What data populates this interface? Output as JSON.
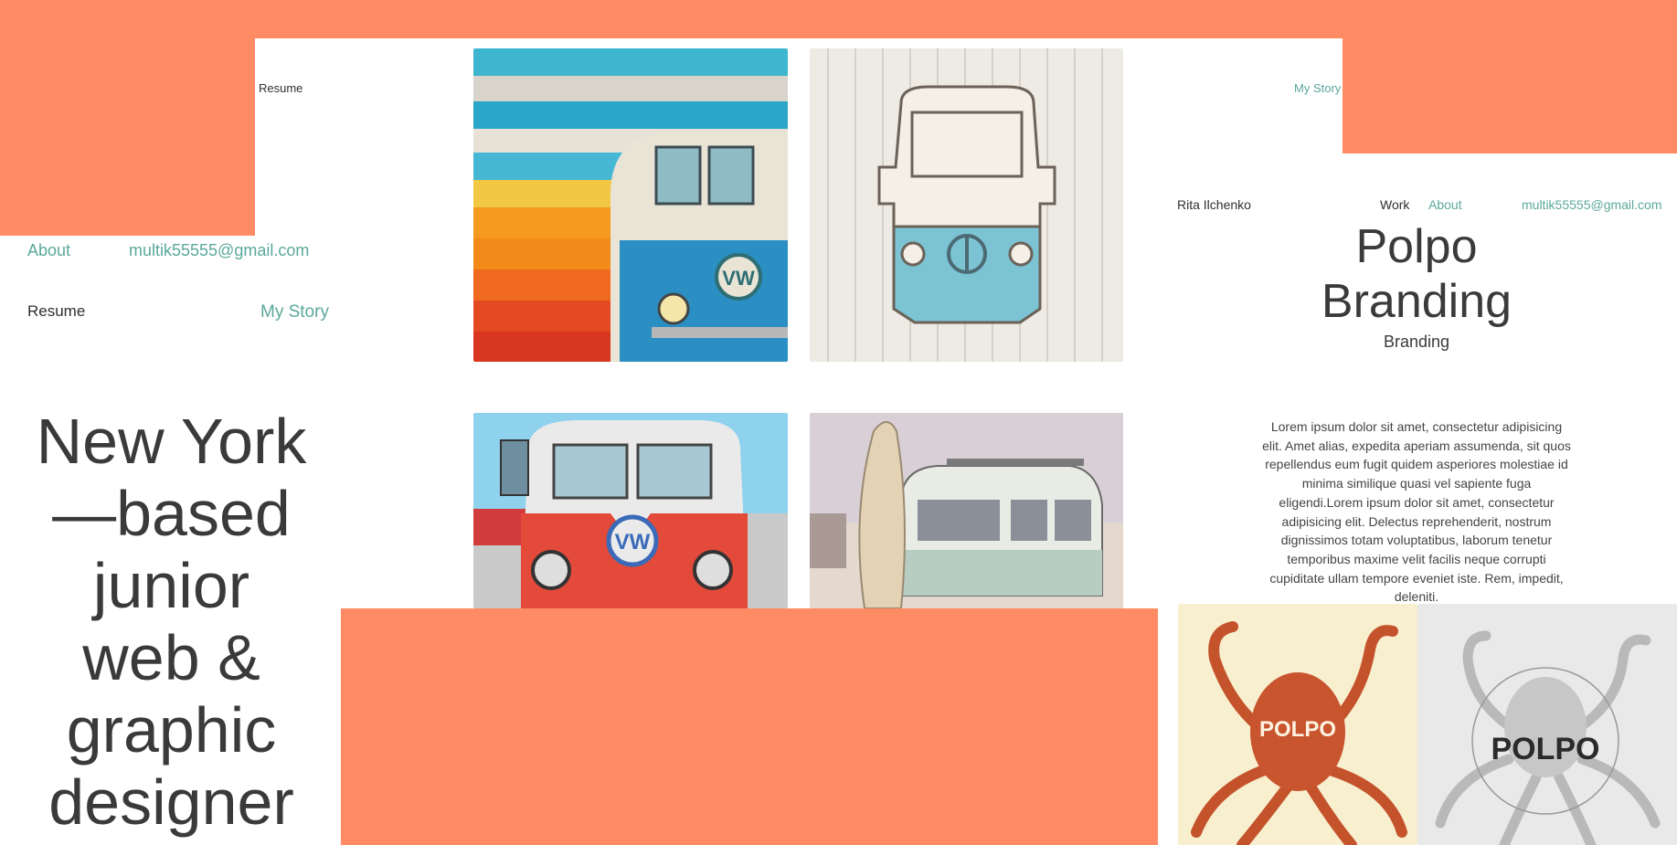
{
  "gallery_nav": {
    "resume": "Resume",
    "my_story": "My Story"
  },
  "left_nav": {
    "about": "About",
    "email": "multik55555@gmail.com",
    "resume": "Resume",
    "my_story": "My Story"
  },
  "hero": {
    "lines": [
      "New York",
      "—based",
      "junior",
      "web &",
      "graphic",
      "designer"
    ]
  },
  "gallery": {
    "tiles": [
      {
        "icon": "painted-vw-bus-image"
      },
      {
        "icon": "wooden-vw-bus-sign-image"
      },
      {
        "icon": "red-vw-bus-image"
      },
      {
        "icon": "vw-bus-surfboard-image"
      }
    ]
  },
  "project": {
    "brand_name": "Rita Ilchenko",
    "nav": {
      "work": "Work",
      "about": "About",
      "email": "multik55555@gmail.com"
    },
    "title_line1": "Polpo",
    "title_line2": "Branding",
    "subtitle": "Branding",
    "description_lines": [
      "Lorem ipsum dolor sit amet, consectetur adipisicing",
      "elit. Amet alias, expedita aperiam assumenda, sit quos",
      "repellendus eum fugit quidem asperiores molestiae id",
      "minima similique quasi vel sapiente fuga",
      "eligendi.Lorem ipsum dolor sit amet, consectetur",
      "adipisicing elit. Delectus reprehenderit, nostrum",
      "dignissimos totam voluptatibus, laborum tenetur",
      "temporibus maxime velit facilis neque corrupti",
      "cupiditate ullam tempore eveniet iste. Rem, impedit,",
      "deleniti."
    ],
    "images": [
      {
        "icon": "orange-octopus-image",
        "logo_text": "POLPO"
      },
      {
        "icon": "gray-octopus-image",
        "logo_text": "POLPO"
      }
    ]
  },
  "colors": {
    "accent": "#ff8b64",
    "teal": "#5aa89b",
    "text": "#3a3a3a"
  }
}
